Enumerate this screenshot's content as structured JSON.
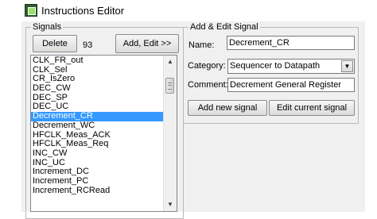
{
  "window": {
    "title": "Instructions Editor"
  },
  "signals": {
    "group_label": "Signals",
    "delete_label": "Delete",
    "count": "93",
    "add_edit_label": "Add, Edit >>",
    "items": [
      "CLK_FR_out",
      "CLK_Sel",
      "CR_IsZero",
      "DEC_CW",
      "DEC_SP",
      "DEC_UC",
      "Decrement_CR",
      "Decrement_WC",
      "HFCLK_Meas_ACK",
      "HFCLK_Meas_Req",
      "INC_CW",
      "INC_UC",
      "Increment_DC",
      "Increment_PC",
      "Increment_RCRead"
    ],
    "selected": "Decrement_CR"
  },
  "edit": {
    "group_label": "Add & Edit Signal",
    "name_label": "Name:",
    "name_value": "Decrement_CR",
    "category_label": "Category:",
    "category_value": "Sequencer to Datapath",
    "comment_label": "Comment:",
    "comment_value": "Decrement General Register",
    "add_new_label": "Add new signal",
    "edit_current_label": "Edit current signal"
  },
  "icons": {
    "app": "app-icon",
    "scroll_up": "scroll-up-icon",
    "scroll_down": "scroll-down-icon",
    "dropdown": "chevron-down-icon"
  },
  "colors": {
    "selection": "#3399ff",
    "window_bg": "#f0f0f0"
  }
}
